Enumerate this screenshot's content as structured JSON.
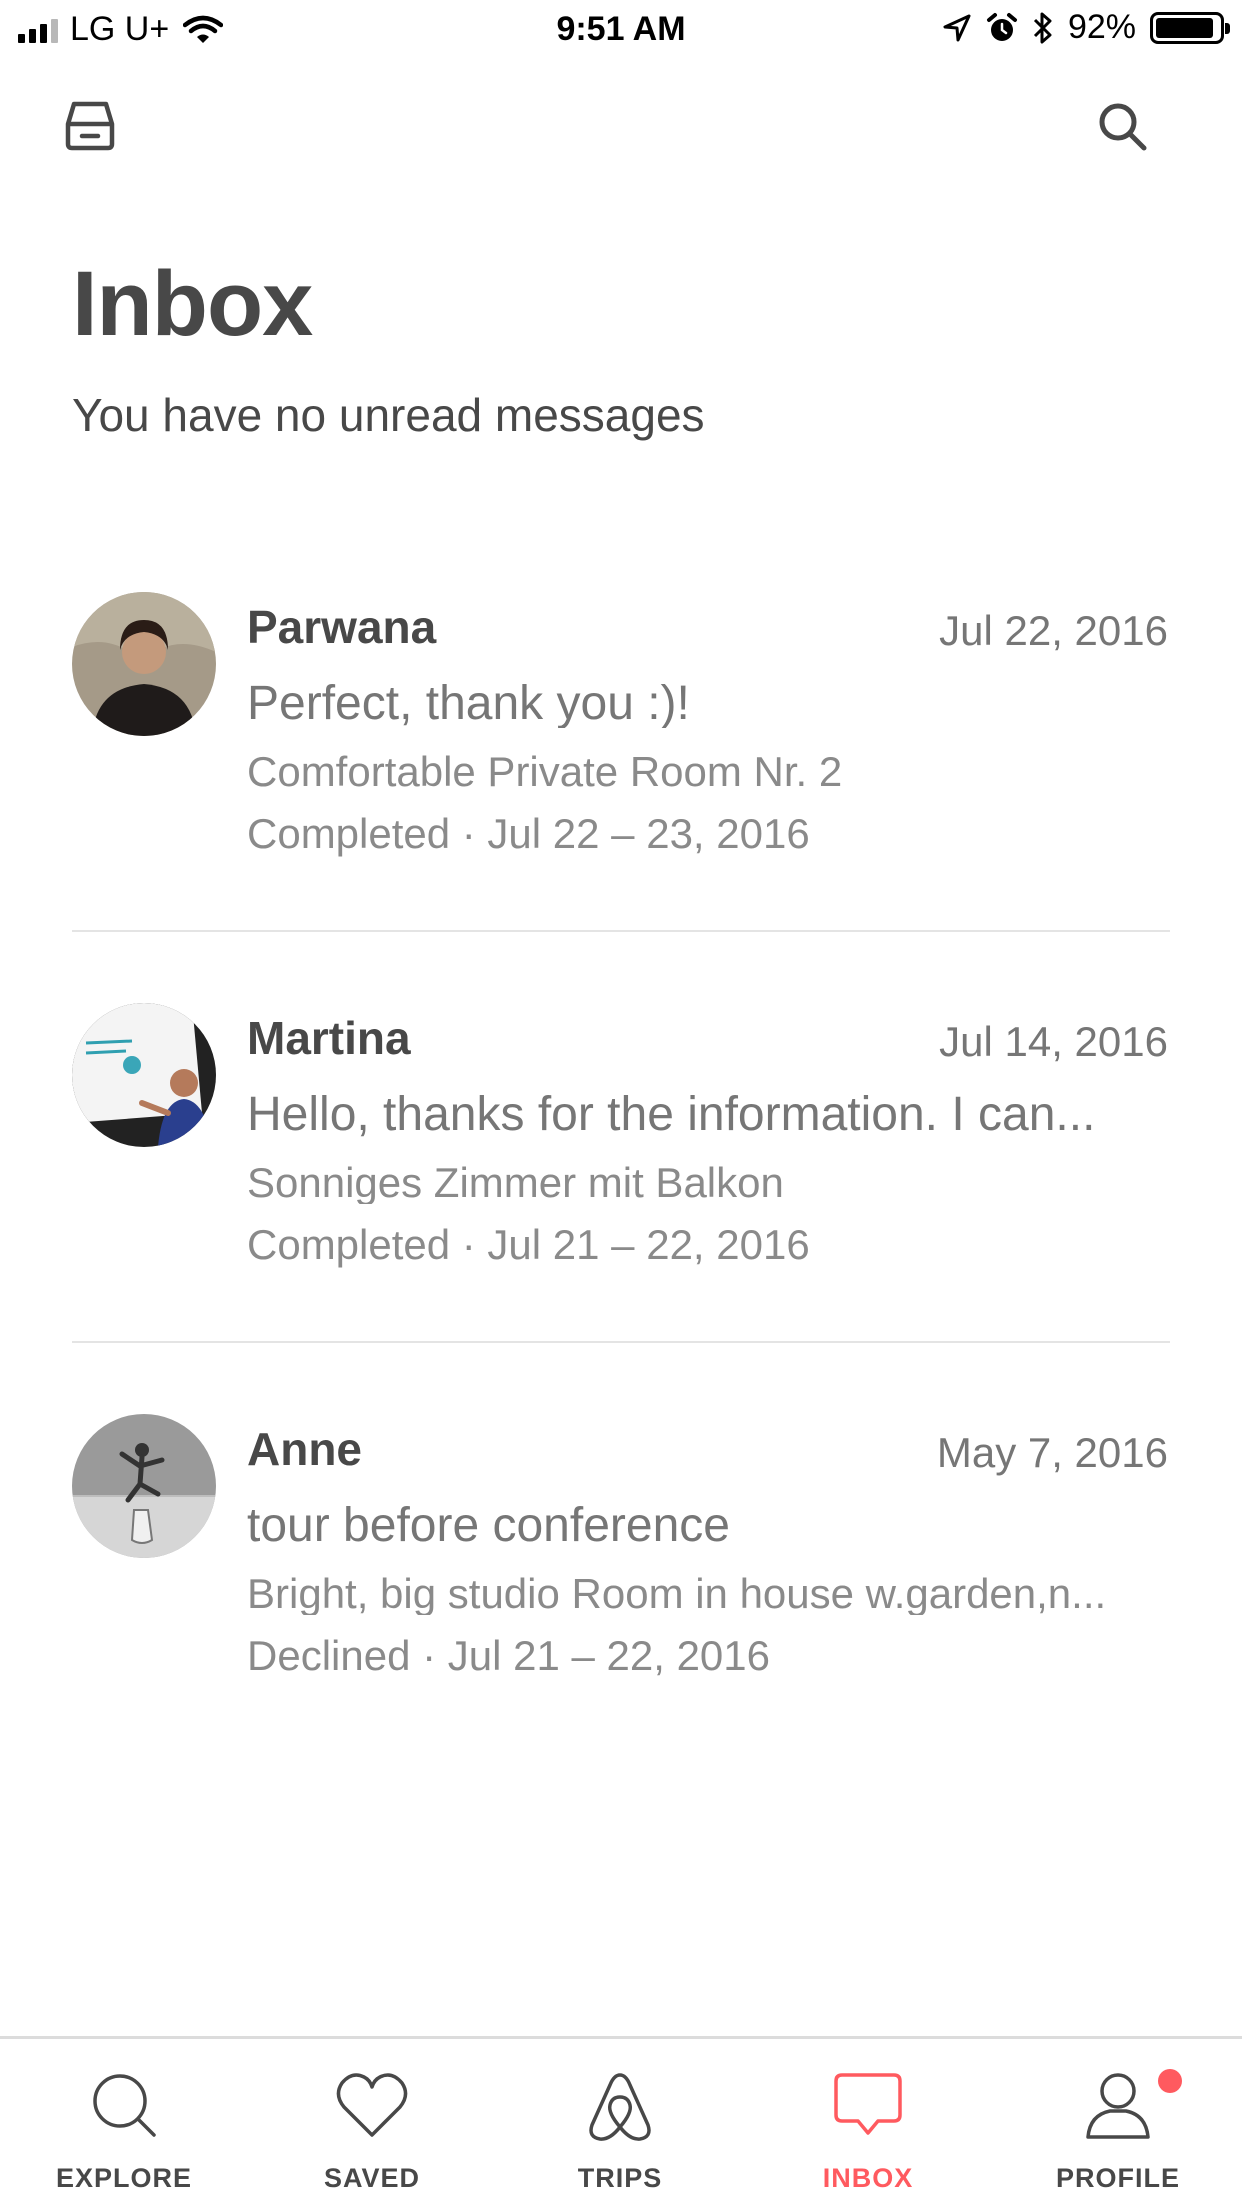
{
  "status_bar": {
    "carrier": "LG U+",
    "time": "9:51 AM",
    "battery_percent": "92%",
    "battery_level": 0.92,
    "icons": [
      "signal-icon",
      "wifi-icon",
      "location-icon",
      "alarm-icon",
      "bluetooth-icon",
      "battery-icon"
    ]
  },
  "toolbar": {
    "left_icon": "archive-icon",
    "right_icon": "search-icon"
  },
  "header": {
    "title": "Inbox",
    "subtitle": "You have no unread messages"
  },
  "conversations": [
    {
      "name": "Parwana",
      "date": "Jul 22, 2016",
      "preview": "Perfect,  thank you :)!",
      "listing": "Comfortable Private Room Nr. 2",
      "status": "Completed · Jul 22 – 23, 2016"
    },
    {
      "name": "Martina",
      "date": "Jul 14, 2016",
      "preview": "Hello, thanks for the information. I can...",
      "listing": "Sonniges Zimmer mit Balkon",
      "status": "Completed · Jul 21 – 22, 2016"
    },
    {
      "name": "Anne",
      "date": "May 7, 2016",
      "preview": "tour before conference",
      "listing": "Bright, big studio Room in house w.garden,n...",
      "status": "Declined · Jul 21 – 22, 2016"
    }
  ],
  "tabs": [
    {
      "label": "EXPLORE",
      "icon": "search-icon",
      "active": false
    },
    {
      "label": "SAVED",
      "icon": "heart-icon",
      "active": false
    },
    {
      "label": "TRIPS",
      "icon": "airbnb-logo-icon",
      "active": false
    },
    {
      "label": "INBOX",
      "icon": "chat-bubble-icon",
      "active": true
    },
    {
      "label": "PROFILE",
      "icon": "person-icon",
      "active": false,
      "notification": true
    }
  ],
  "colors": {
    "accent": "#ff5a5f",
    "text": "#484848",
    "secondary_text": "#767676",
    "divider": "#e4e4e4"
  }
}
